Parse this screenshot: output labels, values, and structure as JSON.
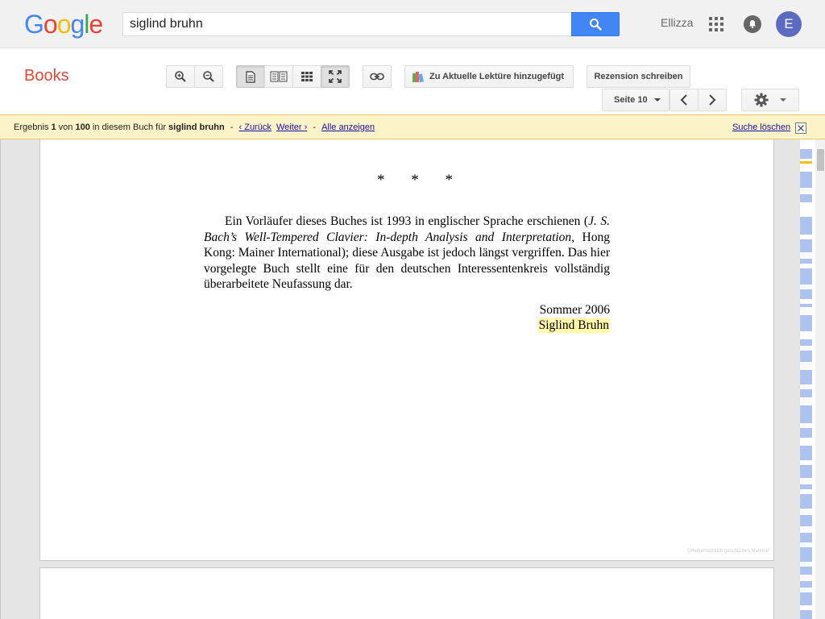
{
  "header": {
    "logo_letters": [
      {
        "ch": "G",
        "color": "#4285f4"
      },
      {
        "ch": "o",
        "color": "#ea4335"
      },
      {
        "ch": "o",
        "color": "#fbbc05"
      },
      {
        "ch": "g",
        "color": "#4285f4"
      },
      {
        "ch": "l",
        "color": "#34a853"
      },
      {
        "ch": "e",
        "color": "#ea4335"
      }
    ],
    "search_value": "siglind bruhn",
    "account_name": "Ellizza",
    "avatar_letter": "E",
    "avatar_color": "#5c6bc0"
  },
  "toolbar": {
    "section_title": "Books",
    "add_to_list_label": "Zu Aktuelle Lektüre hinzugefügt",
    "review_label": "Rezension schreiben",
    "page_label": "Seite 10"
  },
  "resultbar": {
    "prefix": "Ergebnis ",
    "current": "1",
    "of": " von ",
    "total": "100",
    "middle": " in diesem Buch für ",
    "query": "siglind bruhn",
    "sep1": " - ",
    "back": "‹ Zurück",
    "next": "Weiter ›",
    "sep2": " - ",
    "show_all": "Alle anzeigen",
    "clear_search": "Suche löschen"
  },
  "page": {
    "stars": "* * *",
    "para_1": "Ein Vorläufer dieses Buches ist 1993 in englischer Sprache erschienen (",
    "para_italic": "J. S. Bach’s Well-Tempered Clavier: In-depth Analysis and Interpretation",
    "para_2": ", Hong Kong: Mainer International); diese Ausgabe ist jedoch längst vergriffen. Das hier vorgelegte Buch stellt eine für den deutschen Interessentenkreis vollständig überarbeitete Neufassung dar.",
    "date_line": "Sommer 2006",
    "author_line": "Siglind Bruhn",
    "copyright_note": "Urheberrechtlich geschütztes Material"
  },
  "colors": {
    "accent_blue": "#4285f4",
    "books_red": "#dd4b39",
    "result_bg": "#fdf3c8",
    "highlight": "#fef7a8"
  }
}
